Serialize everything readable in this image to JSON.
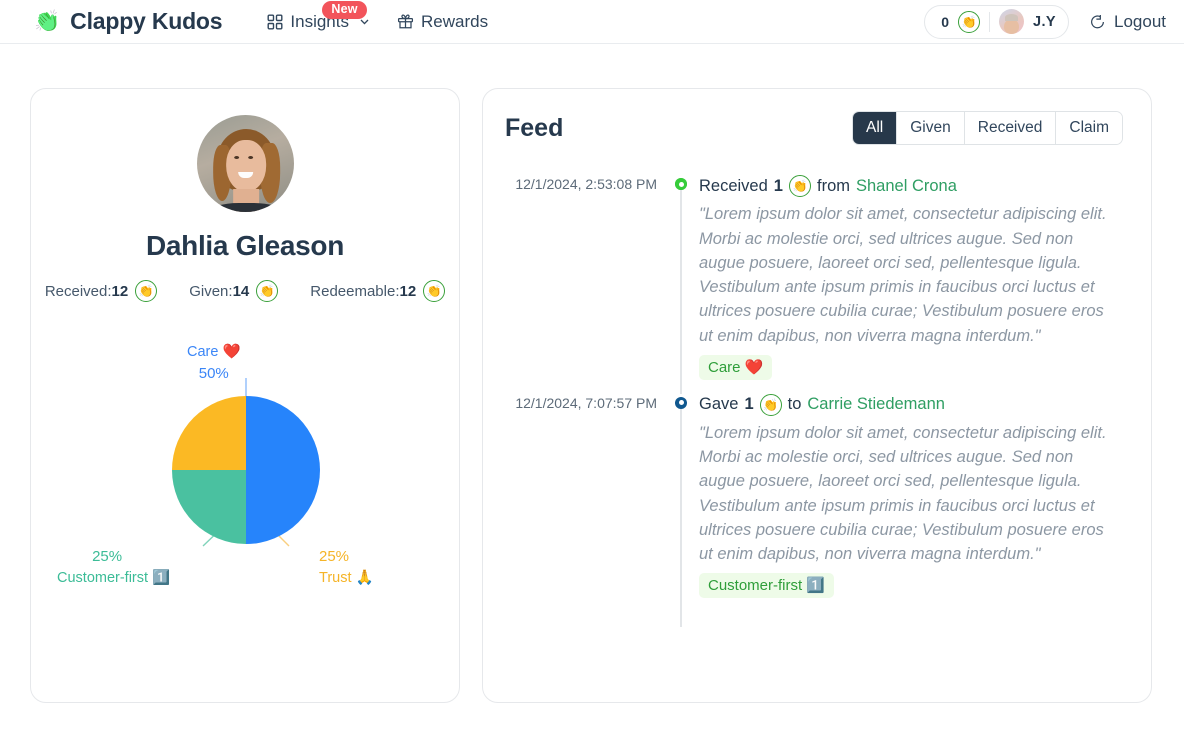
{
  "brand": {
    "emoji": "👏",
    "name": "Clappy Kudos",
    "logo_icon": "clapping-hands-icon"
  },
  "nav": {
    "items": [
      {
        "label": "Insights",
        "icon": "grid-icon",
        "has_chevron": true,
        "badge": "New"
      },
      {
        "label": "Rewards",
        "icon": "gift-icon",
        "has_chevron": false,
        "badge": ""
      }
    ],
    "badge_color": "#f2545b"
  },
  "account": {
    "kudos_count": "0",
    "coin_icon": "clapping-hands-coin-icon",
    "avatar_alt": "user-avatar",
    "initials": "J.Y",
    "logout_label": "Logout",
    "logout_icon": "logout-icon"
  },
  "profile": {
    "avatar_alt": "Dahlia Gleason profile photo",
    "name": "Dahlia Gleason",
    "stats": [
      {
        "label": "Received:",
        "value": "12",
        "icon": "clapping-hands-coin-icon"
      },
      {
        "label": "Given:",
        "value": "14",
        "icon": "clapping-hands-coin-icon"
      },
      {
        "label": "Redeemable:",
        "value": "12",
        "icon": "clapping-hands-coin-icon"
      }
    ]
  },
  "chart_data": {
    "type": "pie",
    "title": "",
    "categories": [
      "Care ❤️",
      "Customer-first 1️⃣",
      "Trust 🙏"
    ],
    "values": [
      50,
      25,
      25
    ],
    "labels": [
      "50%",
      "25%",
      "25%"
    ],
    "colors": [
      "#2684fb",
      "#4ac1a0",
      "#fbb924"
    ],
    "legend_position": "callout-labels",
    "slices": [
      {
        "name": "Care",
        "emoji": "❤️",
        "percent_label": "50%",
        "value": 50,
        "color": "#2684fb",
        "label_color": "#3b86f7"
      },
      {
        "name": "Customer-first",
        "emoji": "1️⃣",
        "percent_label": "25%",
        "value": 25,
        "color": "#4ac1a0",
        "label_color": "#3cbc97"
      },
      {
        "name": "Trust",
        "emoji": "🙏",
        "percent_label": "25%",
        "value": 25,
        "color": "#fbb924",
        "label_color": "#f5b428"
      }
    ]
  },
  "feed": {
    "title": "Feed",
    "filters": [
      {
        "label": "All",
        "active": true
      },
      {
        "label": "Given",
        "active": false
      },
      {
        "label": "Received",
        "active": false
      },
      {
        "label": "Claim",
        "active": false
      }
    ],
    "items": [
      {
        "date": "12/1/2024, 2:53:08 PM",
        "dot_color": "#36cc3a",
        "action": "Received",
        "amount": "1",
        "coin_icon": "clapping-hands-coin-icon",
        "preposition": "from",
        "person": "Shanel Crona",
        "message": "\"Lorem ipsum dolor sit amet, consectetur adipiscing elit. Morbi ac molestie orci, sed ultrices augue. Sed non augue posuere, laoreet orci sed, pellentesque ligula. Vestibulum ante ipsum primis in faucibus orci luctus et ultrices posuere cubilia curae; Vestibulum posuere eros ut enim dapibus, non viverra magna interdum.\"",
        "tag": "Care ❤️"
      },
      {
        "date": "12/1/2024, 7:07:57 PM",
        "dot_color": "#10588f",
        "action": "Gave",
        "amount": "1",
        "coin_icon": "clapping-hands-coin-icon",
        "preposition": "to",
        "person": "Carrie Stiedemann",
        "message": "\"Lorem ipsum dolor sit amet, consectetur adipiscing elit. Morbi ac molestie orci, sed ultrices augue. Sed non augue posuere, laoreet orci sed, pellentesque ligula. Vestibulum ante ipsum primis in faucibus orci luctus et ultrices posuere cubilia curae; Vestibulum posuere eros ut enim dapibus, non viverra magna interdum.\"",
        "tag": "Customer-first 1️⃣"
      }
    ]
  }
}
